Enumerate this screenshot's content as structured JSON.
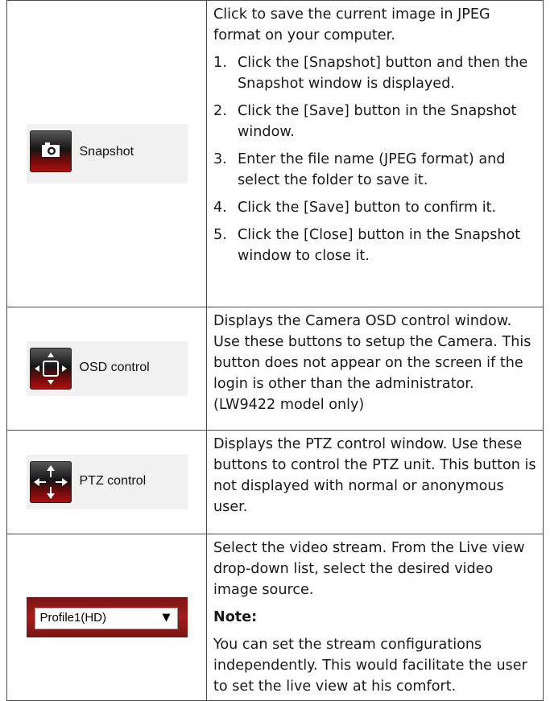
{
  "rows": [
    {
      "button": {
        "label": "Snapshot",
        "icon": "camera-icon"
      },
      "intro": "Click to save the current image in JPEG format on your computer.",
      "steps": [
        {
          "num": "1.",
          "text": "Click the [Snapshot] button and then the Snapshot window is displayed."
        },
        {
          "num": "2.",
          "text": "Click the [Save] button in the Snapshot window."
        },
        {
          "num": "3.",
          "text": "Enter the file name (JPEG format) and select the folder to save it."
        },
        {
          "num": "4.",
          "text": "Click the [Save] button to confirm it."
        },
        {
          "num": "5.",
          "text": "Click the [Close] button in the Snapshot window to close it."
        }
      ]
    },
    {
      "button": {
        "label": "OSD control",
        "icon": "osd-control-icon"
      },
      "text": "Displays the Camera OSD control window. Use these buttons to setup the Camera. This button does not appear on the screen if the login is other than the administrator. (LW9422 model only)"
    },
    {
      "button": {
        "label": "PTZ control",
        "icon": "ptz-arrows-icon"
      },
      "text": "Displays the PTZ control window. Use these buttons to control the PTZ unit. This button is not displayed with normal or anonymous user."
    },
    {
      "select": {
        "value": "Profile1(HD)",
        "icon": "dropdown-arrow-icon"
      },
      "text": "Select the video stream. From the Live view drop-down list, select the desired video image source.",
      "note_heading": "Note:",
      "note_text": "You can set the stream configurations independently. This would facilitate the user to set the live view at his comfort."
    }
  ],
  "colors": {
    "icon_red": "#b01010",
    "profile_bar": "#a41c1c",
    "border": "#4a4a4a"
  }
}
